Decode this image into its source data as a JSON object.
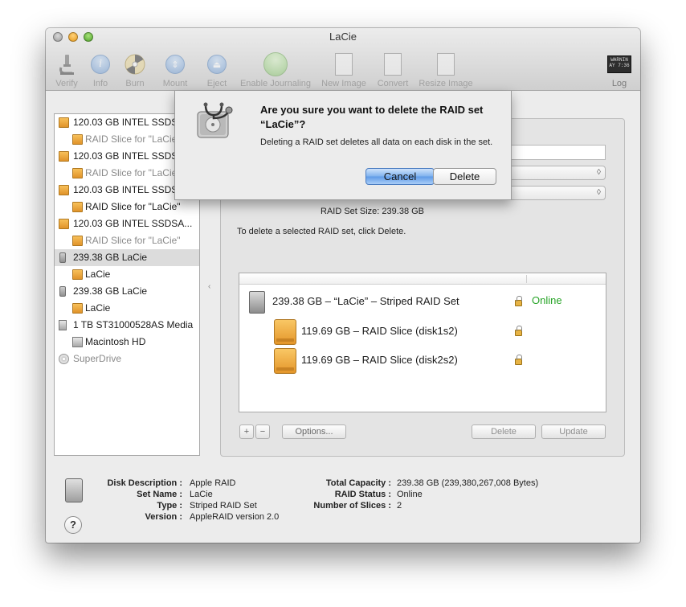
{
  "window": {
    "title": "LaCie"
  },
  "toolbar": {
    "verify": "Verify",
    "info": "Info",
    "burn": "Burn",
    "mount": "Mount",
    "eject": "Eject",
    "enable_journaling": "Enable Journaling",
    "new_image": "New Image",
    "convert": "Convert",
    "resize_image": "Resize Image",
    "log": "Log",
    "log_badge": "WARNIN AY 7:36"
  },
  "sidebar": {
    "items": [
      {
        "label": "120.03 GB INTEL SSDS...",
        "kind": "disk"
      },
      {
        "label": "RAID Slice for \"LaCie\"",
        "kind": "slice"
      },
      {
        "label": "120.03 GB INTEL SSDS...",
        "kind": "disk"
      },
      {
        "label": "RAID Slice for \"LaCie\"",
        "kind": "slice"
      },
      {
        "label": "120.03 GB INTEL SSDS...",
        "kind": "disk"
      },
      {
        "label": "RAID Slice for \"LaCie\"",
        "kind": "slice"
      },
      {
        "label": "120.03 GB INTEL SSDSA...",
        "kind": "disk"
      },
      {
        "label": "RAID Slice for \"LaCie\"",
        "kind": "slice"
      },
      {
        "label": "239.38 GB LaCie",
        "kind": "raid",
        "selected": true
      },
      {
        "label": "LaCie",
        "kind": "volume"
      },
      {
        "label": "239.38 GB LaCie",
        "kind": "raid"
      },
      {
        "label": "LaCie",
        "kind": "volume"
      },
      {
        "label": "1 TB ST31000528AS Media",
        "kind": "internal"
      },
      {
        "label": "Macintosh HD",
        "kind": "internal-volume"
      },
      {
        "label": "SuperDrive",
        "kind": "optical"
      }
    ]
  },
  "raid": {
    "set_size_label": "RAID Set Size:",
    "set_size_value": "239.38 GB",
    "hint": "To delete a selected RAID set, click Delete.",
    "set_row": "239.38 GB – “LaCie” – Striped RAID Set",
    "status": "Online",
    "slice1": "119.69 GB – RAID Slice (disk1s2)",
    "slice2": "119.69 GB – RAID Slice (disk2s2)",
    "add": "+",
    "remove": "−",
    "options": "Options...",
    "delete": "Delete",
    "update": "Update"
  },
  "info": {
    "disk_description_label": "Disk Description :",
    "disk_description": "Apple RAID",
    "set_name_label": "Set Name :",
    "set_name": "LaCie",
    "type_label": "Type :",
    "type": "Striped RAID Set",
    "version_label": "Version :",
    "version": "AppleRAID version 2.0",
    "total_capacity_label": "Total Capacity :",
    "total_capacity": "239.38 GB (239,380,267,008 Bytes)",
    "raid_status_label": "RAID Status :",
    "raid_status": "Online",
    "slices_label": "Number of Slices :",
    "slices": "2",
    "help": "?"
  },
  "sheet": {
    "title": "Are you sure you want to delete the RAID set “LaCie”?",
    "message": "Deleting a RAID set deletes all data on each disk in the set.",
    "cancel": "Cancel",
    "delete": "Delete"
  },
  "colors": {
    "default_button": "#6fa8ec",
    "online_green": "#27a427",
    "disk_orange": "#e8a23a"
  }
}
